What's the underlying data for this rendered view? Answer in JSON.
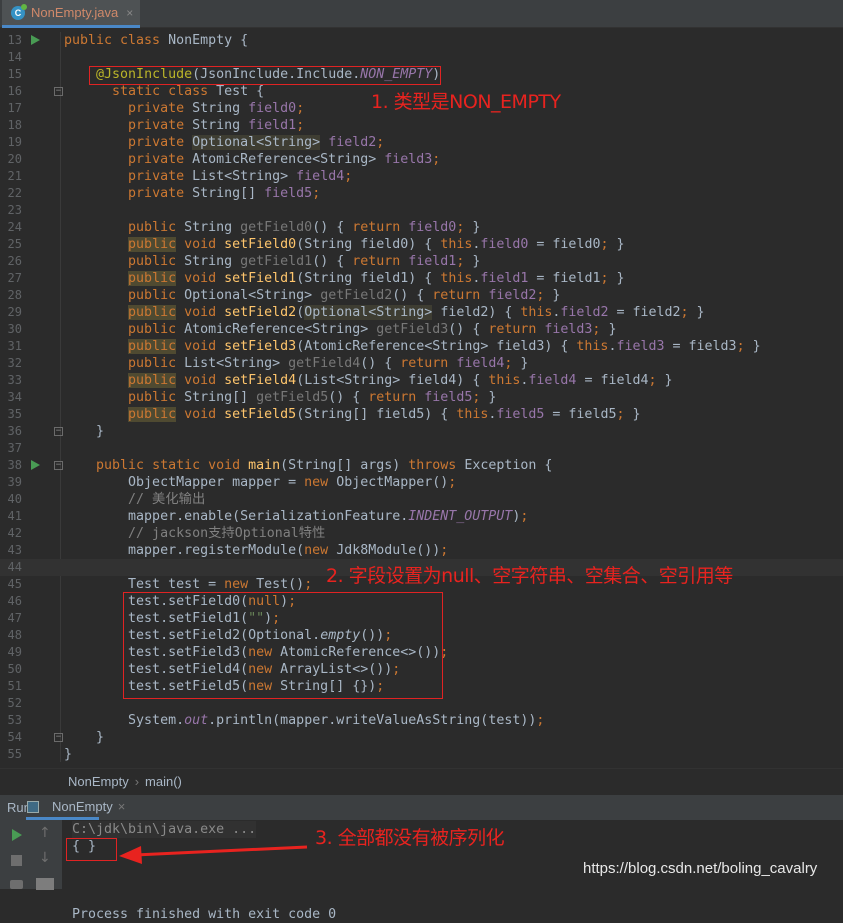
{
  "tab": {
    "title": "NonEmpty.java",
    "icon": "java-class-icon",
    "close": "×"
  },
  "editor": {
    "first_line": 13,
    "current_line": 44,
    "run_lines": [
      13,
      38
    ],
    "fold_lines": [
      16,
      36,
      38,
      54
    ],
    "lines": [
      [
        [
          "k",
          "public class "
        ],
        [
          "p",
          "NonEmpty {"
        ]
      ],
      [],
      [
        [
          "p",
          "    "
        ],
        [
          "a",
          "@JsonInclude"
        ],
        [
          "p",
          "(JsonInclude.Include."
        ],
        [
          "i",
          "NON_EMPTY"
        ],
        [
          "p",
          ")"
        ]
      ],
      [
        [
          "p",
          "      "
        ],
        [
          "k",
          "static class "
        ],
        [
          "p",
          "Test {"
        ]
      ],
      [
        [
          "p",
          "        "
        ],
        [
          "k",
          "private "
        ],
        [
          "p",
          "String "
        ],
        [
          "f",
          "field0"
        ],
        [
          "k",
          ";"
        ]
      ],
      [
        [
          "p",
          "        "
        ],
        [
          "k",
          "private "
        ],
        [
          "p",
          "String "
        ],
        [
          "f",
          "field1"
        ],
        [
          "k",
          ";"
        ]
      ],
      [
        [
          "p",
          "        "
        ],
        [
          "k",
          "private "
        ],
        [
          "hp",
          "Optional<String>"
        ],
        [
          "p",
          " "
        ],
        [
          "f",
          "field2"
        ],
        [
          "k",
          ";"
        ]
      ],
      [
        [
          "p",
          "        "
        ],
        [
          "k",
          "private "
        ],
        [
          "p",
          "AtomicReference<String> "
        ],
        [
          "f",
          "field3"
        ],
        [
          "k",
          ";"
        ]
      ],
      [
        [
          "p",
          "        "
        ],
        [
          "k",
          "private "
        ],
        [
          "p",
          "List<String> "
        ],
        [
          "f",
          "field4"
        ],
        [
          "k",
          ";"
        ]
      ],
      [
        [
          "p",
          "        "
        ],
        [
          "k",
          "private "
        ],
        [
          "p",
          "String[] "
        ],
        [
          "f",
          "field5"
        ],
        [
          "k",
          ";"
        ]
      ],
      [],
      [
        [
          "p",
          "        "
        ],
        [
          "k",
          "public "
        ],
        [
          "p",
          "String "
        ],
        [
          "u",
          "getField0"
        ],
        [
          "p",
          "() { "
        ],
        [
          "k",
          "return "
        ],
        [
          "f",
          "field0"
        ],
        [
          "k",
          "; "
        ],
        [
          "p",
          "}"
        ]
      ],
      [
        [
          "p",
          "        "
        ],
        [
          "hk",
          "public"
        ],
        [
          "p",
          " "
        ],
        [
          "k",
          "void "
        ],
        [
          "m",
          "setField0"
        ],
        [
          "p",
          "(String field0) { "
        ],
        [
          "k",
          "this"
        ],
        [
          "p",
          "."
        ],
        [
          "f",
          "field0"
        ],
        [
          "p",
          " = field0"
        ],
        [
          "k",
          "; "
        ],
        [
          "p",
          "}"
        ]
      ],
      [
        [
          "p",
          "        "
        ],
        [
          "k",
          "public "
        ],
        [
          "p",
          "String "
        ],
        [
          "u",
          "getField1"
        ],
        [
          "p",
          "() { "
        ],
        [
          "k",
          "return "
        ],
        [
          "f",
          "field1"
        ],
        [
          "k",
          "; "
        ],
        [
          "p",
          "}"
        ]
      ],
      [
        [
          "p",
          "        "
        ],
        [
          "hk",
          "public"
        ],
        [
          "p",
          " "
        ],
        [
          "k",
          "void "
        ],
        [
          "m",
          "setField1"
        ],
        [
          "p",
          "(String field1) { "
        ],
        [
          "k",
          "this"
        ],
        [
          "p",
          "."
        ],
        [
          "f",
          "field1"
        ],
        [
          "p",
          " = field1"
        ],
        [
          "k",
          "; "
        ],
        [
          "p",
          "}"
        ]
      ],
      [
        [
          "p",
          "        "
        ],
        [
          "k",
          "public "
        ],
        [
          "p",
          "Optional<String> "
        ],
        [
          "u",
          "getField2"
        ],
        [
          "p",
          "() { "
        ],
        [
          "k",
          "return "
        ],
        [
          "f",
          "field2"
        ],
        [
          "k",
          "; "
        ],
        [
          "p",
          "}"
        ]
      ],
      [
        [
          "p",
          "        "
        ],
        [
          "hk",
          "public"
        ],
        [
          "p",
          " "
        ],
        [
          "k",
          "void "
        ],
        [
          "m",
          "setField2"
        ],
        [
          "p",
          "("
        ],
        [
          "hp",
          "Optional<String>"
        ],
        [
          "p",
          " field2) { "
        ],
        [
          "k",
          "this"
        ],
        [
          "p",
          "."
        ],
        [
          "f",
          "field2"
        ],
        [
          "p",
          " = field2"
        ],
        [
          "k",
          "; "
        ],
        [
          "p",
          "}"
        ]
      ],
      [
        [
          "p",
          "        "
        ],
        [
          "k",
          "public "
        ],
        [
          "p",
          "AtomicReference<String> "
        ],
        [
          "u",
          "getField3"
        ],
        [
          "p",
          "() { "
        ],
        [
          "k",
          "return "
        ],
        [
          "f",
          "field3"
        ],
        [
          "k",
          "; "
        ],
        [
          "p",
          "}"
        ]
      ],
      [
        [
          "p",
          "        "
        ],
        [
          "hk",
          "public"
        ],
        [
          "p",
          " "
        ],
        [
          "k",
          "void "
        ],
        [
          "m",
          "setField3"
        ],
        [
          "p",
          "(AtomicReference<String> field3) { "
        ],
        [
          "k",
          "this"
        ],
        [
          "p",
          "."
        ],
        [
          "f",
          "field3"
        ],
        [
          "p",
          " = field3"
        ],
        [
          "k",
          "; "
        ],
        [
          "p",
          "}"
        ]
      ],
      [
        [
          "p",
          "        "
        ],
        [
          "k",
          "public "
        ],
        [
          "p",
          "List<String> "
        ],
        [
          "u",
          "getField4"
        ],
        [
          "p",
          "() { "
        ],
        [
          "k",
          "return "
        ],
        [
          "f",
          "field4"
        ],
        [
          "k",
          "; "
        ],
        [
          "p",
          "}"
        ]
      ],
      [
        [
          "p",
          "        "
        ],
        [
          "hk",
          "public"
        ],
        [
          "p",
          " "
        ],
        [
          "k",
          "void "
        ],
        [
          "m",
          "setField4"
        ],
        [
          "p",
          "(List<String> field4) { "
        ],
        [
          "k",
          "this"
        ],
        [
          "p",
          "."
        ],
        [
          "f",
          "field4"
        ],
        [
          "p",
          " = field4"
        ],
        [
          "k",
          "; "
        ],
        [
          "p",
          "}"
        ]
      ],
      [
        [
          "p",
          "        "
        ],
        [
          "k",
          "public "
        ],
        [
          "p",
          "String[] "
        ],
        [
          "u",
          "getField5"
        ],
        [
          "p",
          "() { "
        ],
        [
          "k",
          "return "
        ],
        [
          "f",
          "field5"
        ],
        [
          "k",
          "; "
        ],
        [
          "p",
          "}"
        ]
      ],
      [
        [
          "p",
          "        "
        ],
        [
          "hk",
          "public"
        ],
        [
          "p",
          " "
        ],
        [
          "k",
          "void "
        ],
        [
          "m",
          "setField5"
        ],
        [
          "p",
          "(String[] field5) { "
        ],
        [
          "k",
          "this"
        ],
        [
          "p",
          "."
        ],
        [
          "f",
          "field5"
        ],
        [
          "p",
          " = field5"
        ],
        [
          "k",
          "; "
        ],
        [
          "p",
          "}"
        ]
      ],
      [
        [
          "p",
          "    }"
        ]
      ],
      [],
      [
        [
          "p",
          "    "
        ],
        [
          "k",
          "public static void "
        ],
        [
          "m",
          "main"
        ],
        [
          "p",
          "(String[] args) "
        ],
        [
          "k",
          "throws "
        ],
        [
          "p",
          "Exception {"
        ]
      ],
      [
        [
          "p",
          "        ObjectMapper mapper = "
        ],
        [
          "k",
          "new "
        ],
        [
          "p",
          "ObjectMapper()"
        ],
        [
          "k",
          ";"
        ]
      ],
      [
        [
          "c",
          "        // 美化输出"
        ]
      ],
      [
        [
          "p",
          "        mapper.enable(SerializationFeature."
        ],
        [
          "i",
          "INDENT_OUTPUT"
        ],
        [
          "p",
          ")"
        ],
        [
          "k",
          ";"
        ]
      ],
      [
        [
          "c",
          "        // jackson支持Optional特性"
        ]
      ],
      [
        [
          "p",
          "        mapper.registerModule("
        ],
        [
          "k",
          "new "
        ],
        [
          "p",
          "Jdk8Module())"
        ],
        [
          "k",
          ";"
        ]
      ],
      [],
      [
        [
          "p",
          "        Test test = "
        ],
        [
          "k",
          "new "
        ],
        [
          "p",
          "Test()"
        ],
        [
          "k",
          ";"
        ]
      ],
      [
        [
          "p",
          "        test.setField0("
        ],
        [
          "k",
          "null"
        ],
        [
          "p",
          ")"
        ],
        [
          "k",
          ";"
        ]
      ],
      [
        [
          "p",
          "        test.setField1("
        ],
        [
          "s",
          "\"\""
        ],
        [
          "p",
          ")"
        ],
        [
          "k",
          ";"
        ]
      ],
      [
        [
          "p",
          "        test.setField2(Optional."
        ],
        [
          "ii",
          "empty"
        ],
        [
          "p",
          "())"
        ],
        [
          "k",
          ";"
        ]
      ],
      [
        [
          "p",
          "        test.setField3("
        ],
        [
          "k",
          "new "
        ],
        [
          "p",
          "AtomicReference<>())"
        ],
        [
          "k",
          ";"
        ]
      ],
      [
        [
          "p",
          "        test.setField4("
        ],
        [
          "k",
          "new "
        ],
        [
          "p",
          "ArrayList<>())"
        ],
        [
          "k",
          ";"
        ]
      ],
      [
        [
          "p",
          "        test.setField5("
        ],
        [
          "k",
          "new "
        ],
        [
          "p",
          "String[] {})"
        ],
        [
          "k",
          ";"
        ]
      ],
      [],
      [
        [
          "p",
          "        System."
        ],
        [
          "i",
          "out"
        ],
        [
          "p",
          ".println(mapper.writeValueAsString(test))"
        ],
        [
          "k",
          ";"
        ]
      ],
      [
        [
          "p",
          "    }"
        ]
      ],
      [
        [
          "p",
          "}"
        ]
      ]
    ]
  },
  "breadcrumb": [
    "NonEmpty",
    "main()"
  ],
  "run_panel": {
    "label": "Run:",
    "tab": "NonEmpty",
    "close": "×",
    "console": [
      "C:\\jdk\\bin\\java.exe ...",
      "{ }",
      "",
      "Process finished with exit code 0"
    ]
  },
  "annotations": {
    "note1": "1. 类型是NON_EMPTY",
    "note2": "2. 字段设置为null、空字符串、空集合、空引用等",
    "note3": "3. 全部都没有被序列化",
    "color": "#e8231f"
  },
  "watermark": "https://blog.csdn.net/boling_cavalry"
}
